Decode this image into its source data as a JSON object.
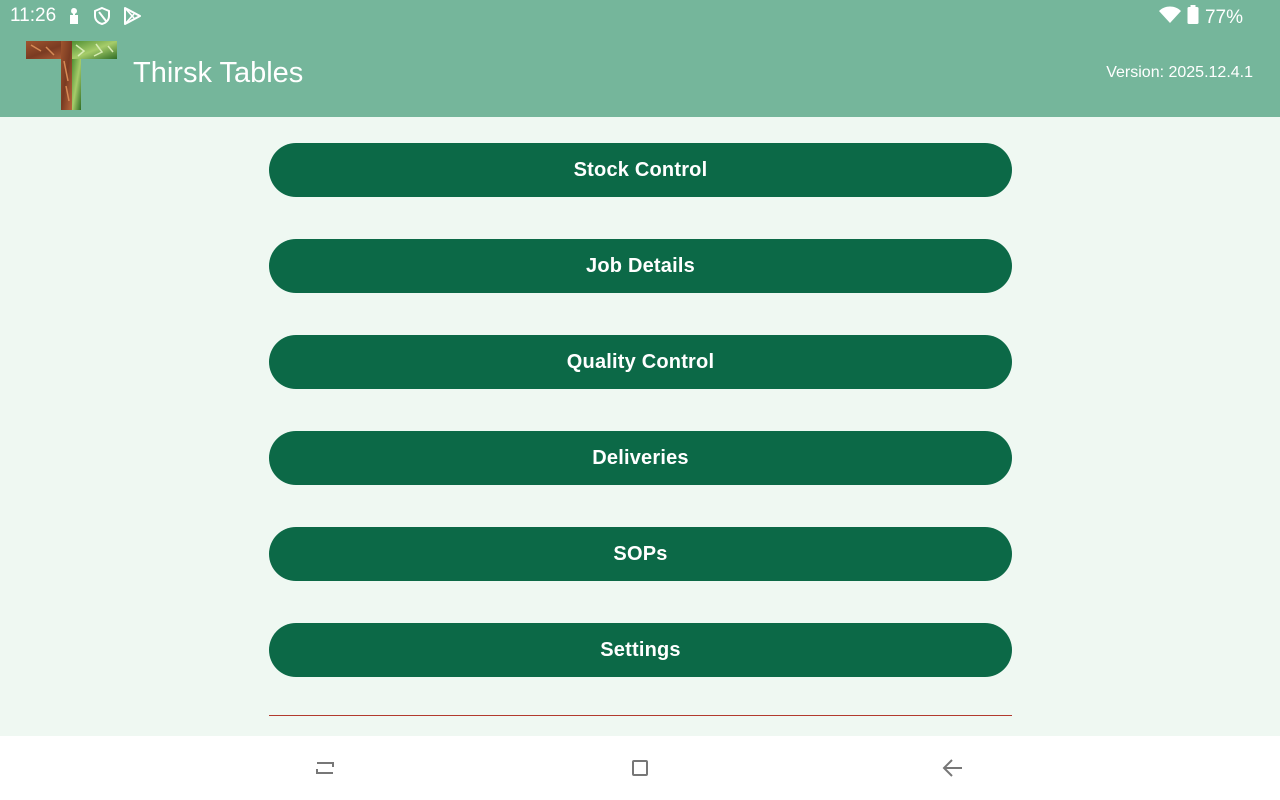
{
  "status_bar": {
    "time": "11:26",
    "battery_percent": "77%",
    "icons": [
      "person-pin-icon",
      "shield-icon",
      "play-store-icon",
      "wifi-icon",
      "battery-icon"
    ]
  },
  "header": {
    "title": "Thirsk Tables",
    "version": "Version: 2025.12.4.1",
    "logo_icon": "t-logo"
  },
  "menu": {
    "items": [
      {
        "label": "Stock Control"
      },
      {
        "label": "Job Details"
      },
      {
        "label": "Quality Control"
      },
      {
        "label": "Deliveries"
      },
      {
        "label": "SOPs"
      },
      {
        "label": "Settings"
      }
    ]
  },
  "nav_bar": {
    "icons": [
      "recents-icon",
      "home-icon",
      "back-icon"
    ]
  },
  "colors": {
    "app_bar": "#75b69b",
    "background": "#eff8f2",
    "button": "#0c6947",
    "divider": "#b23a2e"
  }
}
